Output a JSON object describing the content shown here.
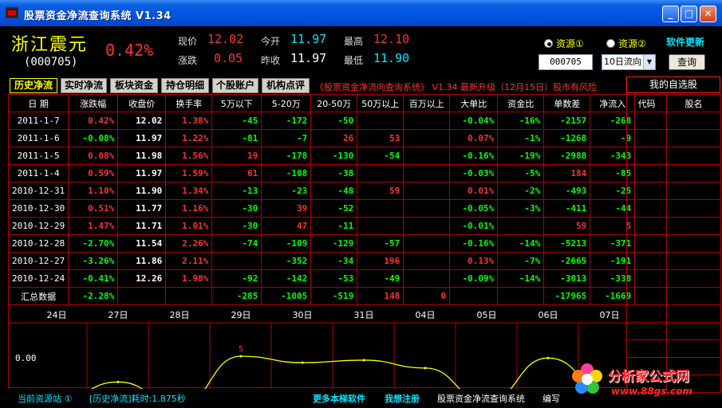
{
  "window": {
    "title": "股票资金净流查询系统  V1.34"
  },
  "stock": {
    "name": "浙江震元",
    "code": "(000705)",
    "change_pct": "0.42%"
  },
  "quote": {
    "price_label": "现价",
    "price": "12.02",
    "open_label": "今开",
    "open": "11.97",
    "high_label": "最高",
    "high": "12.10",
    "chg_label": "涨跌",
    "chg": "0.05",
    "prev_label": "昨收",
    "prev": "11.97",
    "low_label": "最低",
    "low": "11.90"
  },
  "source": {
    "option1": "资源①",
    "option2": "资源②",
    "selected": "option1",
    "update_label": "软件更新"
  },
  "query": {
    "code_value": "000705",
    "period_value": "10日流向",
    "button": "查询"
  },
  "tabs": [
    "历史净流",
    "实时净流",
    "板块资金",
    "持仓明细",
    "个股账户",
    "机构点评"
  ],
  "active_tab": 0,
  "marquee": "《股票资金净流向查询系统》 V1.34  最新升级（12月15日）股市有风险",
  "watchlist": {
    "title": "我的自选股",
    "col_code": "代码",
    "col_name": "股名"
  },
  "table": {
    "headers": [
      "日 期",
      "涨跌幅",
      "收盘价",
      "换手率",
      "5万以下",
      "5-20万",
      "20-50万",
      "50万以上",
      "百万以上",
      "大单比",
      "资金比",
      "单数差",
      "净流入"
    ],
    "rows": [
      [
        "2011-1-7",
        "0.42%",
        "12.02",
        "1.38%",
        "-45",
        "-172",
        "-50",
        "",
        "",
        "-0.04%",
        "-16%",
        "-2157",
        "-268"
      ],
      [
        "2011-1-6",
        "-0.08%",
        "11.97",
        "1.22%",
        "-81",
        "-7",
        "26",
        "53",
        "",
        "0.07%",
        "-1%",
        "-1268",
        "-9"
      ],
      [
        "2011-1-5",
        "0.08%",
        "11.98",
        "1.56%",
        "19",
        "-178",
        "-130",
        "-54",
        "",
        "-0.16%",
        "-19%",
        "-2988",
        "-343"
      ],
      [
        "2011-1-4",
        "0.59%",
        "11.97",
        "1.59%",
        "61",
        "-108",
        "-38",
        "",
        "",
        "-0.03%",
        "-5%",
        "184",
        "-85"
      ],
      [
        "2010-12-31",
        "1.10%",
        "11.90",
        "1.34%",
        "-13",
        "-23",
        "-48",
        "59",
        "",
        "0.01%",
        "-2%",
        "-493",
        "-25"
      ],
      [
        "2010-12-30",
        "0.51%",
        "11.77",
        "1.16%",
        "-30",
        "39",
        "-52",
        "",
        "",
        "-0.05%",
        "-3%",
        "-411",
        "-44"
      ],
      [
        "2010-12-29",
        "1.47%",
        "11.71",
        "1.01%",
        "-30",
        "47",
        "-11",
        "",
        "",
        "-0.01%",
        "",
        "59",
        "5"
      ],
      [
        "2010-12-28",
        "-2.70%",
        "11.54",
        "2.26%",
        "-74",
        "-109",
        "-129",
        "-57",
        "",
        "-0.16%",
        "-14%",
        "-5213",
        "-371"
      ],
      [
        "2010-12-27",
        "-3.26%",
        "11.86",
        "2.11%",
        "",
        "-352",
        "-34",
        "196",
        "",
        "0.13%",
        "-7%",
        "-2665",
        "-191"
      ],
      [
        "2010-12-24",
        "-0.41%",
        "12.26",
        "1.98%",
        "-92",
        "-142",
        "-53",
        "-49",
        "",
        "-0.09%",
        "-14%",
        "-3013",
        "-338"
      ]
    ],
    "summary": [
      "汇总数据",
      "-2.28%",
      "",
      "",
      "-285",
      "-1005",
      "-519",
      "148",
      "0",
      "",
      "",
      "-17965",
      "-1669"
    ]
  },
  "chart_data": {
    "type": "line",
    "categories": [
      "24日",
      "27日",
      "28日",
      "29日",
      "30日",
      "31日",
      "04日",
      "05日",
      "06日",
      "07日"
    ],
    "series": [
      {
        "values": [
          -338,
          -191,
          -371,
          5,
          -44,
          -25,
          -85,
          -343,
          -9,
          -268
        ]
      }
    ],
    "zero_label": "0.00",
    "annotations": [
      "5",
      "-371"
    ],
    "line_color": "#ffff00",
    "grid": true
  },
  "status": {
    "source": "当前资源站 ①",
    "timing": "[历史净流]耗时:1.875秒",
    "more": "更多本梯软件",
    "contact": "我想注册",
    "app": "股票资金净流查询系统",
    "edit": "编写"
  },
  "logo": {
    "brand": "分析家公式网",
    "url": "www.88gs.com"
  },
  "colors": {
    "up": "#ff3030",
    "down": "#00ff00",
    "border": "#b00000",
    "title_bg": "#0054e3"
  }
}
